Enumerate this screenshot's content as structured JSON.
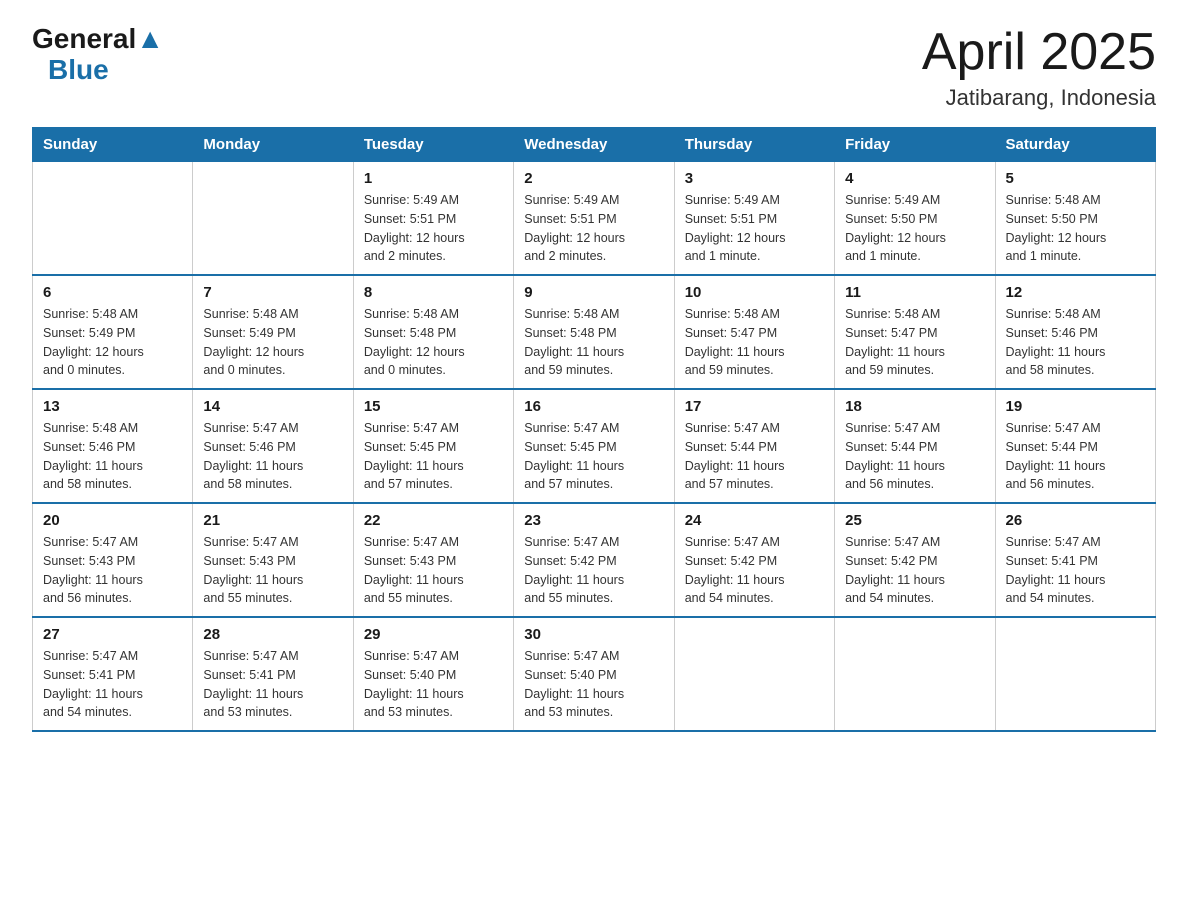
{
  "header": {
    "logo_general": "General",
    "logo_blue": "Blue",
    "month_title": "April 2025",
    "location": "Jatibarang, Indonesia"
  },
  "days_of_week": [
    "Sunday",
    "Monday",
    "Tuesday",
    "Wednesday",
    "Thursday",
    "Friday",
    "Saturday"
  ],
  "weeks": [
    [
      {
        "day": "",
        "info": ""
      },
      {
        "day": "",
        "info": ""
      },
      {
        "day": "1",
        "info": "Sunrise: 5:49 AM\nSunset: 5:51 PM\nDaylight: 12 hours\nand 2 minutes."
      },
      {
        "day": "2",
        "info": "Sunrise: 5:49 AM\nSunset: 5:51 PM\nDaylight: 12 hours\nand 2 minutes."
      },
      {
        "day": "3",
        "info": "Sunrise: 5:49 AM\nSunset: 5:51 PM\nDaylight: 12 hours\nand 1 minute."
      },
      {
        "day": "4",
        "info": "Sunrise: 5:49 AM\nSunset: 5:50 PM\nDaylight: 12 hours\nand 1 minute."
      },
      {
        "day": "5",
        "info": "Sunrise: 5:48 AM\nSunset: 5:50 PM\nDaylight: 12 hours\nand 1 minute."
      }
    ],
    [
      {
        "day": "6",
        "info": "Sunrise: 5:48 AM\nSunset: 5:49 PM\nDaylight: 12 hours\nand 0 minutes."
      },
      {
        "day": "7",
        "info": "Sunrise: 5:48 AM\nSunset: 5:49 PM\nDaylight: 12 hours\nand 0 minutes."
      },
      {
        "day": "8",
        "info": "Sunrise: 5:48 AM\nSunset: 5:48 PM\nDaylight: 12 hours\nand 0 minutes."
      },
      {
        "day": "9",
        "info": "Sunrise: 5:48 AM\nSunset: 5:48 PM\nDaylight: 11 hours\nand 59 minutes."
      },
      {
        "day": "10",
        "info": "Sunrise: 5:48 AM\nSunset: 5:47 PM\nDaylight: 11 hours\nand 59 minutes."
      },
      {
        "day": "11",
        "info": "Sunrise: 5:48 AM\nSunset: 5:47 PM\nDaylight: 11 hours\nand 59 minutes."
      },
      {
        "day": "12",
        "info": "Sunrise: 5:48 AM\nSunset: 5:46 PM\nDaylight: 11 hours\nand 58 minutes."
      }
    ],
    [
      {
        "day": "13",
        "info": "Sunrise: 5:48 AM\nSunset: 5:46 PM\nDaylight: 11 hours\nand 58 minutes."
      },
      {
        "day": "14",
        "info": "Sunrise: 5:47 AM\nSunset: 5:46 PM\nDaylight: 11 hours\nand 58 minutes."
      },
      {
        "day": "15",
        "info": "Sunrise: 5:47 AM\nSunset: 5:45 PM\nDaylight: 11 hours\nand 57 minutes."
      },
      {
        "day": "16",
        "info": "Sunrise: 5:47 AM\nSunset: 5:45 PM\nDaylight: 11 hours\nand 57 minutes."
      },
      {
        "day": "17",
        "info": "Sunrise: 5:47 AM\nSunset: 5:44 PM\nDaylight: 11 hours\nand 57 minutes."
      },
      {
        "day": "18",
        "info": "Sunrise: 5:47 AM\nSunset: 5:44 PM\nDaylight: 11 hours\nand 56 minutes."
      },
      {
        "day": "19",
        "info": "Sunrise: 5:47 AM\nSunset: 5:44 PM\nDaylight: 11 hours\nand 56 minutes."
      }
    ],
    [
      {
        "day": "20",
        "info": "Sunrise: 5:47 AM\nSunset: 5:43 PM\nDaylight: 11 hours\nand 56 minutes."
      },
      {
        "day": "21",
        "info": "Sunrise: 5:47 AM\nSunset: 5:43 PM\nDaylight: 11 hours\nand 55 minutes."
      },
      {
        "day": "22",
        "info": "Sunrise: 5:47 AM\nSunset: 5:43 PM\nDaylight: 11 hours\nand 55 minutes."
      },
      {
        "day": "23",
        "info": "Sunrise: 5:47 AM\nSunset: 5:42 PM\nDaylight: 11 hours\nand 55 minutes."
      },
      {
        "day": "24",
        "info": "Sunrise: 5:47 AM\nSunset: 5:42 PM\nDaylight: 11 hours\nand 54 minutes."
      },
      {
        "day": "25",
        "info": "Sunrise: 5:47 AM\nSunset: 5:42 PM\nDaylight: 11 hours\nand 54 minutes."
      },
      {
        "day": "26",
        "info": "Sunrise: 5:47 AM\nSunset: 5:41 PM\nDaylight: 11 hours\nand 54 minutes."
      }
    ],
    [
      {
        "day": "27",
        "info": "Sunrise: 5:47 AM\nSunset: 5:41 PM\nDaylight: 11 hours\nand 54 minutes."
      },
      {
        "day": "28",
        "info": "Sunrise: 5:47 AM\nSunset: 5:41 PM\nDaylight: 11 hours\nand 53 minutes."
      },
      {
        "day": "29",
        "info": "Sunrise: 5:47 AM\nSunset: 5:40 PM\nDaylight: 11 hours\nand 53 minutes."
      },
      {
        "day": "30",
        "info": "Sunrise: 5:47 AM\nSunset: 5:40 PM\nDaylight: 11 hours\nand 53 minutes."
      },
      {
        "day": "",
        "info": ""
      },
      {
        "day": "",
        "info": ""
      },
      {
        "day": "",
        "info": ""
      }
    ]
  ]
}
